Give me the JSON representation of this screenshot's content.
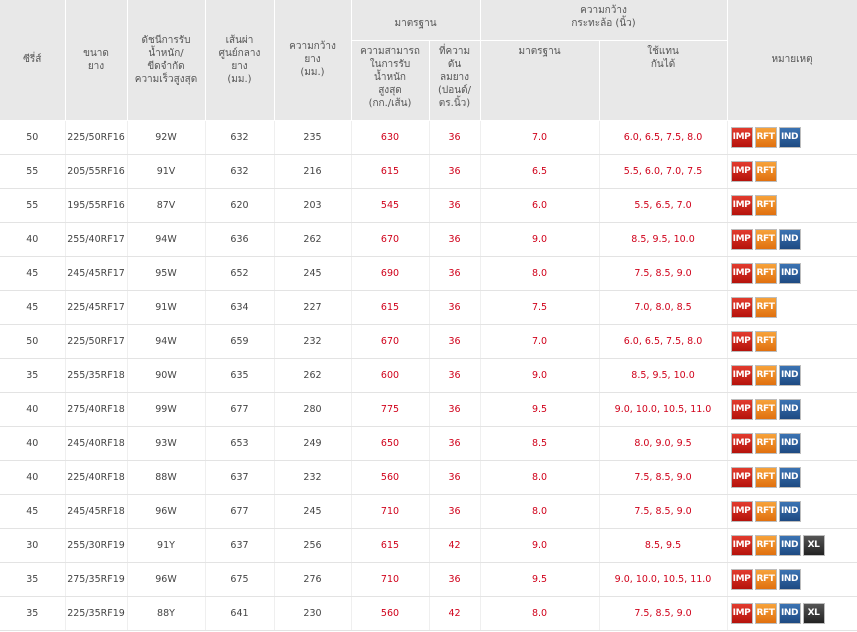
{
  "headers": {
    "series": "ซีรี่ส์",
    "size": "ขนาด\nยาง",
    "load_index": "ดัชนีการรับ\nน้ำหนัก/\nขีดจำกัด\nความเร็วสูงสุด",
    "diameter": "เส้นผ่า\nศูนย์กลาง\nยาง\n(มม.)",
    "width": "ความกว้าง\nยาง\n(มม.)",
    "standard_group": "มาตรฐาน",
    "max_load": "ความสามารถ\nในการรับ\nน้ำหนัก\nสูงสุด\n(กก./เส้น)",
    "pressure": "ที่ความ\nดัน\nลมยาง\n(ปอนด์/\nตร.นิ้ว)",
    "rim_group": "ความกว้าง\nกระทะล้อ (นิ้ว)",
    "rim_standard": "มาตรฐาน",
    "rim_alt": "ใช้แทน\nกันได้",
    "notes": "หมายเหตุ"
  },
  "badge_labels": {
    "IMP": "IMP",
    "RFT": "RFT",
    "IND": "IND",
    "XL": "XL"
  },
  "rows": [
    {
      "series": "50",
      "size": "225/50RF16",
      "load": "92W",
      "diameter": "632",
      "width": "235",
      "max_load": "630",
      "pressure": "36",
      "rim_std": "7.0",
      "rim_alt": "6.0, 6.5, 7.5, 8.0",
      "badges": [
        "IMP",
        "RFT",
        "IND"
      ]
    },
    {
      "series": "55",
      "size": "205/55RF16",
      "load": "91V",
      "diameter": "632",
      "width": "216",
      "max_load": "615",
      "pressure": "36",
      "rim_std": "6.5",
      "rim_alt": "5.5, 6.0, 7.0, 7.5",
      "badges": [
        "IMP",
        "RFT"
      ]
    },
    {
      "series": "55",
      "size": "195/55RF16",
      "load": "87V",
      "diameter": "620",
      "width": "203",
      "max_load": "545",
      "pressure": "36",
      "rim_std": "6.0",
      "rim_alt": "5.5, 6.5, 7.0",
      "badges": [
        "IMP",
        "RFT"
      ]
    },
    {
      "series": "40",
      "size": "255/40RF17",
      "load": "94W",
      "diameter": "636",
      "width": "262",
      "max_load": "670",
      "pressure": "36",
      "rim_std": "9.0",
      "rim_alt": "8.5, 9.5, 10.0",
      "badges": [
        "IMP",
        "RFT",
        "IND"
      ]
    },
    {
      "series": "45",
      "size": "245/45RF17",
      "load": "95W",
      "diameter": "652",
      "width": "245",
      "max_load": "690",
      "pressure": "36",
      "rim_std": "8.0",
      "rim_alt": "7.5, 8.5, 9.0",
      "badges": [
        "IMP",
        "RFT",
        "IND"
      ]
    },
    {
      "series": "45",
      "size": "225/45RF17",
      "load": "91W",
      "diameter": "634",
      "width": "227",
      "max_load": "615",
      "pressure": "36",
      "rim_std": "7.5",
      "rim_alt": "7.0, 8.0, 8.5",
      "badges": [
        "IMP",
        "RFT"
      ]
    },
    {
      "series": "50",
      "size": "225/50RF17",
      "load": "94W",
      "diameter": "659",
      "width": "232",
      "max_load": "670",
      "pressure": "36",
      "rim_std": "7.0",
      "rim_alt": "6.0, 6.5, 7.5, 8.0",
      "badges": [
        "IMP",
        "RFT"
      ]
    },
    {
      "series": "35",
      "size": "255/35RF18",
      "load": "90W",
      "diameter": "635",
      "width": "262",
      "max_load": "600",
      "pressure": "36",
      "rim_std": "9.0",
      "rim_alt": "8.5, 9.5, 10.0",
      "badges": [
        "IMP",
        "RFT",
        "IND"
      ]
    },
    {
      "series": "40",
      "size": "275/40RF18",
      "load": "99W",
      "diameter": "677",
      "width": "280",
      "max_load": "775",
      "pressure": "36",
      "rim_std": "9.5",
      "rim_alt": "9.0, 10.0, 10.5, 11.0",
      "badges": [
        "IMP",
        "RFT",
        "IND"
      ]
    },
    {
      "series": "40",
      "size": "245/40RF18",
      "load": "93W",
      "diameter": "653",
      "width": "249",
      "max_load": "650",
      "pressure": "36",
      "rim_std": "8.5",
      "rim_alt": "8.0, 9.0, 9.5",
      "badges": [
        "IMP",
        "RFT",
        "IND"
      ]
    },
    {
      "series": "40",
      "size": "225/40RF18",
      "load": "88W",
      "diameter": "637",
      "width": "232",
      "max_load": "560",
      "pressure": "36",
      "rim_std": "8.0",
      "rim_alt": "7.5, 8.5, 9.0",
      "badges": [
        "IMP",
        "RFT",
        "IND"
      ]
    },
    {
      "series": "45",
      "size": "245/45RF18",
      "load": "96W",
      "diameter": "677",
      "width": "245",
      "max_load": "710",
      "pressure": "36",
      "rim_std": "8.0",
      "rim_alt": "7.5, 8.5, 9.0",
      "badges": [
        "IMP",
        "RFT",
        "IND"
      ]
    },
    {
      "series": "30",
      "size": "255/30RF19",
      "load": "91Y",
      "diameter": "637",
      "width": "256",
      "max_load": "615",
      "pressure": "42",
      "rim_std": "9.0",
      "rim_alt": "8.5, 9.5",
      "badges": [
        "IMP",
        "RFT",
        "IND",
        "XL"
      ]
    },
    {
      "series": "35",
      "size": "275/35RF19",
      "load": "96W",
      "diameter": "675",
      "width": "276",
      "max_load": "710",
      "pressure": "36",
      "rim_std": "9.5",
      "rim_alt": "9.0, 10.0, 10.5, 11.0",
      "badges": [
        "IMP",
        "RFT",
        "IND"
      ]
    },
    {
      "series": "35",
      "size": "225/35RF19",
      "load": "88Y",
      "diameter": "641",
      "width": "230",
      "max_load": "560",
      "pressure": "42",
      "rim_std": "8.0",
      "rim_alt": "7.5, 8.5, 9.0",
      "badges": [
        "IMP",
        "RFT",
        "IND",
        "XL"
      ]
    }
  ]
}
